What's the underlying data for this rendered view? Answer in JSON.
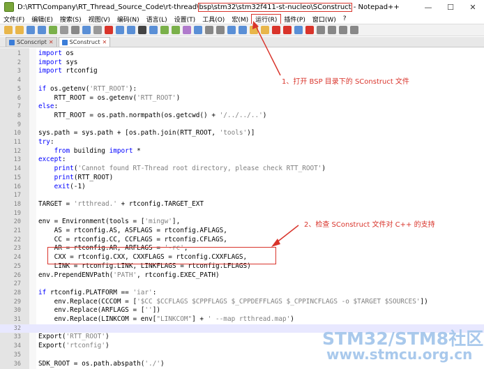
{
  "window": {
    "title_prefix": "D:\\RTT\\Company\\RT_Thread_Source_Code\\rt-thread\\",
    "title_highlight": "bsp\\stm32\\stm32f411-st-nucleo\\SConstruct",
    "title_suffix": " - Notepad++",
    "minimize": "—",
    "maximize": "☐",
    "close": "✕"
  },
  "menu": [
    "文件(F)",
    "编辑(E)",
    "搜索(S)",
    "视图(V)",
    "编码(N)",
    "语言(L)",
    "设置(T)",
    "工具(O)",
    "宏(M)",
    "运行(R)",
    "插件(P)",
    "窗口(W)",
    "?"
  ],
  "tabs": [
    {
      "label": "SConscript",
      "active": false
    },
    {
      "label": "SConstruct",
      "active": true
    }
  ],
  "lines": [
    {
      "n": "1",
      "code": "import os"
    },
    {
      "n": "2",
      "code": "import sys"
    },
    {
      "n": "3",
      "code": "import rtconfig"
    },
    {
      "n": "4",
      "code": ""
    },
    {
      "n": "5",
      "code": "if os.getenv('RTT_ROOT'):"
    },
    {
      "n": "6",
      "code": "    RTT_ROOT = os.getenv('RTT_ROOT')"
    },
    {
      "n": "7",
      "code": "else:"
    },
    {
      "n": "8",
      "code": "    RTT_ROOT = os.path.normpath(os.getcwd() + '/../../..')"
    },
    {
      "n": "9",
      "code": ""
    },
    {
      "n": "10",
      "code": "sys.path = sys.path + [os.path.join(RTT_ROOT, 'tools')]"
    },
    {
      "n": "11",
      "code": "try:"
    },
    {
      "n": "12",
      "code": "    from building import *"
    },
    {
      "n": "13",
      "code": "except:"
    },
    {
      "n": "14",
      "code": "    print('Cannot found RT-Thread root directory, please check RTT_ROOT')"
    },
    {
      "n": "15",
      "code": "    print(RTT_ROOT)"
    },
    {
      "n": "16",
      "code": "    exit(-1)"
    },
    {
      "n": "17",
      "code": ""
    },
    {
      "n": "18",
      "code": "TARGET = 'rtthread.' + rtconfig.TARGET_EXT"
    },
    {
      "n": "19",
      "code": ""
    },
    {
      "n": "20",
      "code": "env = Environment(tools = ['mingw'],"
    },
    {
      "n": "21",
      "code": "    AS = rtconfig.AS, ASFLAGS = rtconfig.AFLAGS,"
    },
    {
      "n": "22",
      "code": "    CC = rtconfig.CC, CCFLAGS = rtconfig.CFLAGS,"
    },
    {
      "n": "23",
      "code": "    AR = rtconfig.AR, ARFLAGS = '-rc',"
    },
    {
      "n": "24",
      "code": "    CXX = rtconfig.CXX, CXXFLAGS = rtconfig.CXXFLAGS,"
    },
    {
      "n": "25",
      "code": "    LINK = rtconfig.LINK, LINKFLAGS = rtconfig.LFLAGS)"
    },
    {
      "n": "26",
      "code": "env.PrependENVPath('PATH', rtconfig.EXEC_PATH)"
    },
    {
      "n": "27",
      "code": ""
    },
    {
      "n": "28",
      "code": "if rtconfig.PLATFORM == 'iar':"
    },
    {
      "n": "29",
      "code": "    env.Replace(CCCOM = ['$CC $CCFLAGS $CPPFLAGS $_CPPDEFFLAGS $_CPPINCFLAGS -o $TARGET $SOURCES'])"
    },
    {
      "n": "30",
      "code": "    env.Replace(ARFLAGS = [''])"
    },
    {
      "n": "31",
      "code": "    env.Replace(LINKCOM = env[\"LINKCOM\"] + ' --map rtthread.map')"
    },
    {
      "n": "32",
      "code": ""
    },
    {
      "n": "33",
      "code": "Export('RTT_ROOT')"
    },
    {
      "n": "34",
      "code": "Export('rtconfig')"
    },
    {
      "n": "35",
      "code": ""
    },
    {
      "n": "36",
      "code": "SDK_ROOT = os.path.abspath('./')"
    }
  ],
  "annotations": {
    "note1": "1、打开 BSP 目录下的 SConstruct 文件",
    "note2": "2、检查 SConstruct 文件对 C++ 的支持",
    "color": "#d9342b"
  },
  "watermark": {
    "line1": "STM32/STM8社区",
    "line2": "www.stmcu.org.cn"
  }
}
